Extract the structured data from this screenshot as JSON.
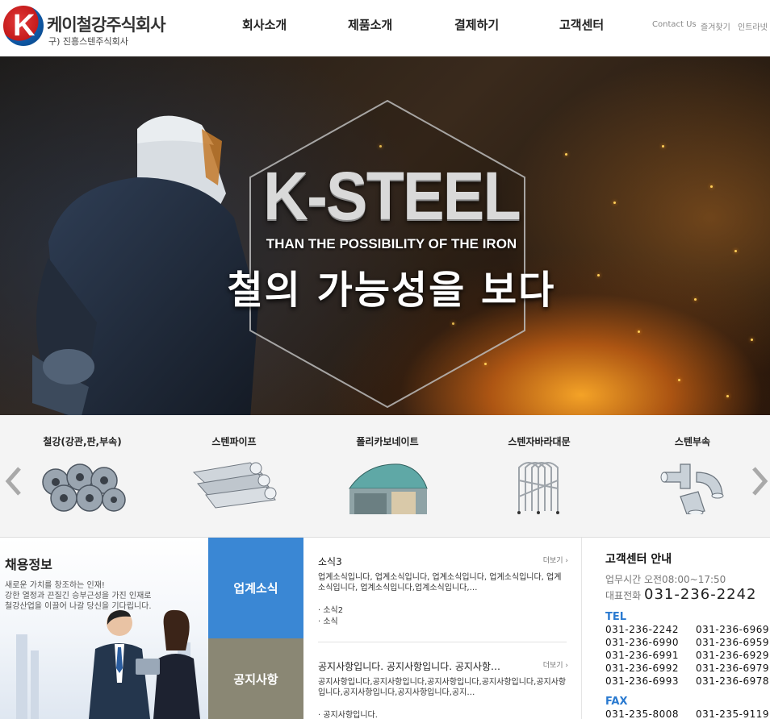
{
  "header": {
    "logo_letter": "K",
    "company_name": "케이철강주식회사",
    "company_former": "구) 진흥스텐주식회사",
    "nav": [
      "회사소개",
      "제품소개",
      "결제하기",
      "고객센터"
    ],
    "util": [
      "Contact Us",
      "즐겨찾기",
      "인트라넷"
    ]
  },
  "hero": {
    "title": "K-STEEL",
    "subtitle": "THAN THE POSSIBILITY OF THE IRON",
    "slogan": "철의 가능성을 보다"
  },
  "products": {
    "items": [
      {
        "label": "철강(강관,판,부속)",
        "icon": "steel-coils"
      },
      {
        "label": "스텐파이프",
        "icon": "steel-pipes"
      },
      {
        "label": "폴리카보네이트",
        "icon": "polycarbonate-canopy"
      },
      {
        "label": "스텐자바라대문",
        "icon": "folding-gate"
      },
      {
        "label": "스텐부속",
        "icon": "pipe-fittings"
      }
    ]
  },
  "recruit": {
    "title": "채용정보",
    "lines": [
      "새로운 가치를 창조하는 인재!",
      "강한 열정과 끈질긴 승부근성을 가진 인재로",
      "철강산업을 이끌어 나갈 당신을 기다립니다."
    ]
  },
  "tabs": [
    "업계소식",
    "공지사항"
  ],
  "news": {
    "more_label": "더보기 ›",
    "industry": {
      "title": "소식3",
      "body": "업계소식입니다, 업계소식입니다, 업계소식입니다, 업계소식입니다, 업계소식입니다, 업계소식입니다,업계소식입니다,…",
      "items": [
        "·  소식2",
        "·  소식"
      ]
    },
    "notice": {
      "title": "공지사항입니다. 공지사항입니다. 공지사항…",
      "body": "공지사항입니다,공지사항입니다,공지사항입니다,공지사항입니다,공지사항입니다,공지사항입니다,공지사항입니다,공지…",
      "items": [
        "·  공지사항입니다."
      ]
    }
  },
  "customer_center": {
    "title": "고객센터 안내",
    "hours": "업무시간 오전08:00~17:50",
    "rep_label": "대표전화",
    "rep_number": "031-236-2242",
    "tel_label": "TEL",
    "tel": [
      [
        "031-236-2242",
        "031-236-6969"
      ],
      [
        "031-236-6990",
        "031-236-6959"
      ],
      [
        "031-236-6991",
        "031-236-6929"
      ],
      [
        "031-236-6992",
        "031-236-6979"
      ],
      [
        "031-236-6993",
        "031-236-6978"
      ]
    ],
    "fax_label": "FAX",
    "fax": [
      "031-235-8008",
      "031-235-9119"
    ]
  },
  "colors": {
    "accent_blue": "#3a87d4",
    "tab_grey": "#8a8774",
    "cs_blue": "#2a7ad0"
  }
}
